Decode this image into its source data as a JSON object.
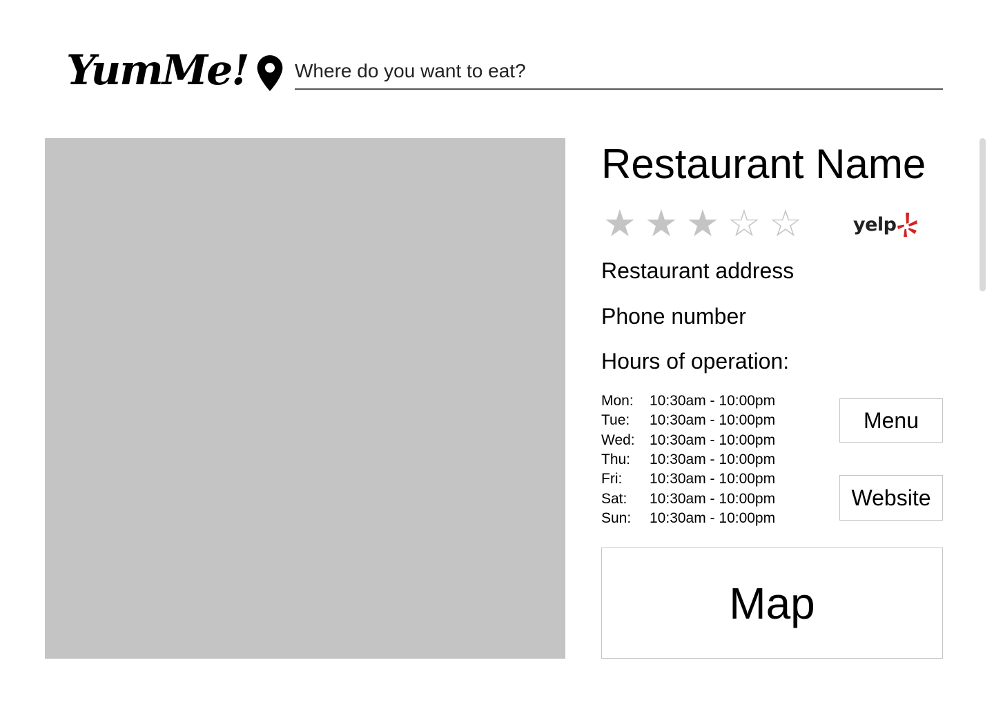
{
  "header": {
    "logo_text": "YumMe!",
    "location_icon": "map-pin-icon",
    "search": {
      "placeholder": "Where do you want to eat?",
      "value": ""
    }
  },
  "restaurant": {
    "name": "Restaurant Name",
    "rating": 3,
    "rating_max": 5,
    "rating_source_logo": "yelp",
    "address": "Restaurant address",
    "phone": "Phone number",
    "hours_label": "Hours of operation:",
    "hours": [
      {
        "day": "Mon:",
        "time": "10:30am - 10:00pm"
      },
      {
        "day": "Tue:",
        "time": "10:30am - 10:00pm"
      },
      {
        "day": "Wed:",
        "time": "10:30am - 10:00pm"
      },
      {
        "day": "Thu:",
        "time": "10:30am - 10:00pm"
      },
      {
        "day": "Fri:",
        "time": "10:30am - 10:00pm"
      },
      {
        "day": "Sat:",
        "time": "10:30am - 10:00pm"
      },
      {
        "day": "Sun:",
        "time": "10:30am - 10:00pm"
      }
    ]
  },
  "actions": {
    "menu_label": "Menu",
    "website_label": "Website",
    "map_label": "Map"
  },
  "colors": {
    "placeholder_gray": "#c4c4c4",
    "yelp_red": "#d32323",
    "text": "#000000"
  }
}
